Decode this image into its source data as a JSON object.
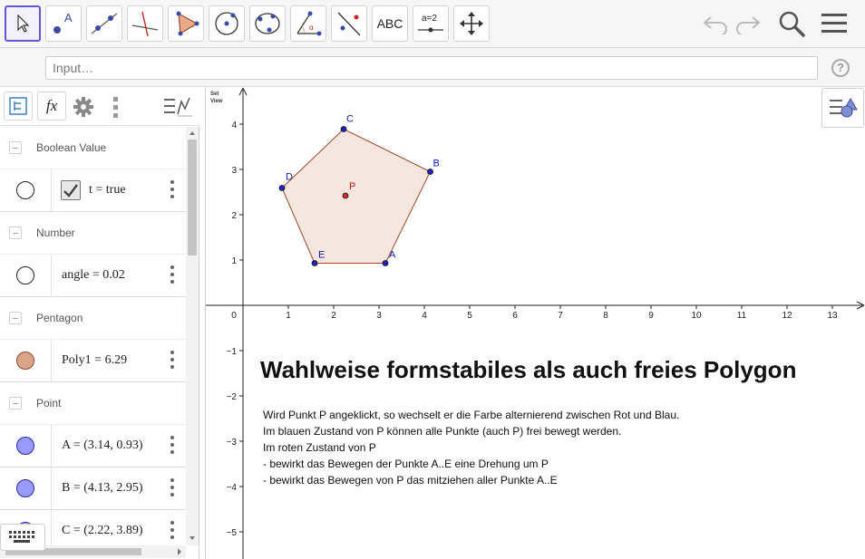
{
  "toolbar": {
    "tools": [
      {
        "name": "move-tool",
        "icon": "arrow-pointer-icon",
        "selected": true
      },
      {
        "name": "point-tool",
        "icon": "point-icon"
      },
      {
        "name": "line-tool",
        "icon": "line-icon"
      },
      {
        "name": "perpendicular-tool",
        "icon": "perpendicular-line-icon"
      },
      {
        "name": "polygon-tool",
        "icon": "polygon-icon"
      },
      {
        "name": "circle-center-tool",
        "icon": "circle-center-icon"
      },
      {
        "name": "circle-three-points-tool",
        "icon": "circle-three-points-icon"
      },
      {
        "name": "angle-tool",
        "icon": "angle-icon"
      },
      {
        "name": "reflect-tool",
        "icon": "reflect-line-icon"
      },
      {
        "name": "text-tool",
        "icon": "text-icon",
        "label": "ABC"
      },
      {
        "name": "slider-tool",
        "icon": "slider-icon",
        "label": "a = 2"
      },
      {
        "name": "move-view-tool",
        "icon": "move-graphics-icon"
      }
    ],
    "undo_icon": "undo-icon",
    "redo_icon": "redo-icon",
    "search_icon": "search-icon",
    "menu_icon": "hamburger-menu-icon"
  },
  "input_bar": {
    "placeholder": "Input…",
    "help_label": "?"
  },
  "algebra_view": {
    "tabs": [
      "sort-icon",
      "fx-icon",
      "gear-icon",
      "more-vertical-icon",
      "style-bar-icon"
    ],
    "fx_label": "fx",
    "groups": [
      {
        "label": "Boolean Value",
        "items": [
          {
            "text": "t = true",
            "marker": "checkbox",
            "checked": true
          }
        ]
      },
      {
        "label": "Number",
        "items": [
          {
            "text": "angle = 0.02",
            "marker": "circle-empty"
          }
        ]
      },
      {
        "label": "Pentagon",
        "items": [
          {
            "text": "Poly1 = 6.29",
            "marker": "circle-filled",
            "color": "#d9a48a"
          }
        ]
      },
      {
        "label": "Point",
        "items": [
          {
            "text": "A = (3.14, 0.93)",
            "marker": "circle-filled",
            "color": "#9999ff"
          },
          {
            "text": "B = (4.13, 2.95)",
            "marker": "circle-filled",
            "color": "#9999ff"
          },
          {
            "text": "C = (2.22, 3.89)",
            "marker": "circle-filled",
            "color": "#9999ff"
          }
        ]
      }
    ]
  },
  "graphics_view": {
    "set_view_label_1": "Set",
    "set_view_label_2": "View",
    "x_ticks": [
      "0",
      "1",
      "2",
      "3",
      "4",
      "5",
      "6",
      "7",
      "8",
      "9",
      "10",
      "11",
      "12",
      "13"
    ],
    "y_ticks": [
      "4",
      "3",
      "2",
      "1",
      "−1",
      "−2",
      "−3",
      "−4",
      "−5"
    ],
    "points": [
      {
        "label": "A",
        "x": 3.14,
        "y": 0.93,
        "color": "#1515bd"
      },
      {
        "label": "B",
        "x": 4.13,
        "y": 2.95,
        "color": "#1515bd"
      },
      {
        "label": "C",
        "x": 2.22,
        "y": 3.89,
        "color": "#1515bd"
      },
      {
        "label": "D",
        "x": 0.86,
        "y": 2.59,
        "color": "#1515bd"
      },
      {
        "label": "E",
        "x": 1.58,
        "y": 0.93,
        "color": "#1515bd"
      },
      {
        "label": "P",
        "x": 2.26,
        "y": 2.42,
        "color": "#cc1010"
      }
    ],
    "polygon_fill": "#f5e6e0",
    "polygon_stroke": "#a04a28",
    "title": "Wahlweise formstabiles als auch freies Polygon",
    "description": [
      "Wird Punkt P angeklickt, so wechselt er die Farbe alternierend zwischen Rot und Blau.",
      "Im blauen Zustand von P können alle Punkte (auch P) frei bewegt werden.",
      "Im roten Zustand von P",
      "- bewirkt das Bewegen der Punkte A..E eine Drehung um P",
      "- bewirkt das Bewegen von P das mitziehen aller Punkte A..E"
    ]
  }
}
